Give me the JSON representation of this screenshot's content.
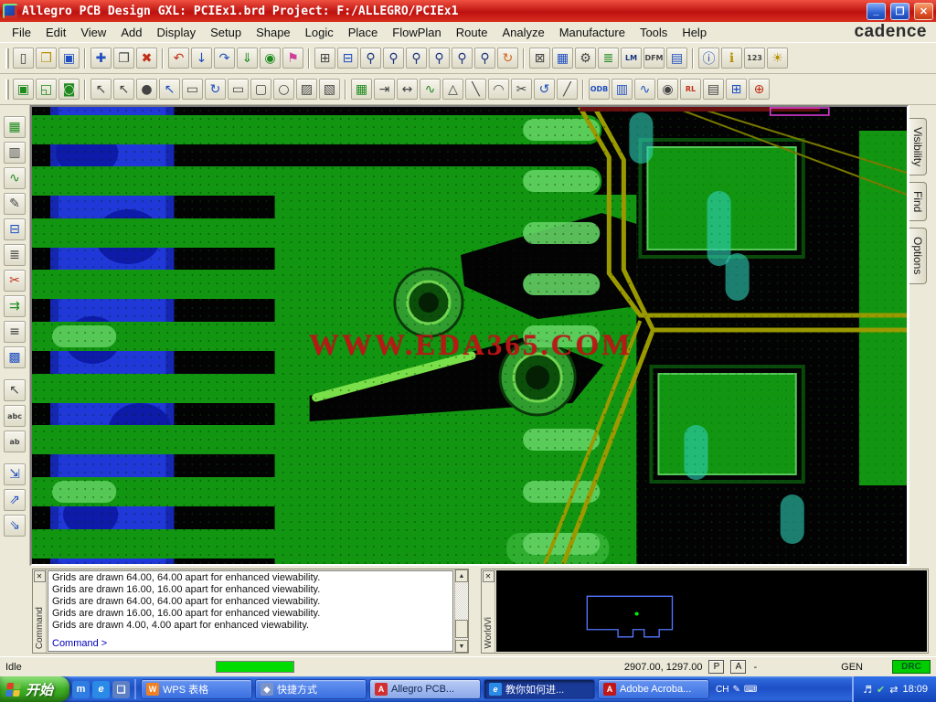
{
  "window": {
    "title": "Allegro PCB Design GXL: PCIEx1.brd  Project: F:/ALLEGRO/PCIEx1",
    "brand": "cadence",
    "minimize": "_",
    "maximize": "❐",
    "close": "✕"
  },
  "menu": {
    "items": [
      "File",
      "Edit",
      "View",
      "Add",
      "Display",
      "Setup",
      "Shape",
      "Logic",
      "Place",
      "FlowPlan",
      "Route",
      "Analyze",
      "Manufacture",
      "Tools",
      "Help"
    ]
  },
  "toolbar_row1": [
    {
      "name": "new-drawing-icon",
      "glyph": "▯"
    },
    {
      "name": "open-drawing-icon",
      "glyph": "❒"
    },
    {
      "name": "save-icon",
      "glyph": "▣"
    },
    {
      "name": "move-icon",
      "glyph": "✚"
    },
    {
      "name": "copy-icon",
      "glyph": "❐"
    },
    {
      "name": "delete-icon",
      "glyph": "✖"
    },
    {
      "name": "undo-icon",
      "glyph": "↶"
    },
    {
      "name": "cancel-icon",
      "glyph": "↓"
    },
    {
      "name": "redo-icon",
      "glyph": "↷"
    },
    {
      "name": "done-icon",
      "glyph": "⇓"
    },
    {
      "name": "zoom-world-icon",
      "glyph": "◉"
    },
    {
      "name": "pin-icon",
      "glyph": "⚑"
    },
    {
      "name": "windows-icon",
      "glyph": "⊞"
    },
    {
      "name": "grid-toggle-icon",
      "glyph": "⊟"
    },
    {
      "name": "zoom-points-icon",
      "glyph": "⚲"
    },
    {
      "name": "zoom-fit-icon",
      "glyph": "⚲"
    },
    {
      "name": "zoom-in-icon",
      "glyph": "⚲"
    },
    {
      "name": "zoom-out-icon",
      "glyph": "⚲"
    },
    {
      "name": "zoom-previous-icon",
      "glyph": "⚲"
    },
    {
      "name": "zoom-selection-icon",
      "glyph": "⚲"
    },
    {
      "name": "redraw-icon",
      "glyph": "↻"
    },
    {
      "name": "rats-all-icon",
      "glyph": "⊠"
    },
    {
      "name": "color-dialog-icon",
      "glyph": "▦"
    },
    {
      "name": "component-icon",
      "glyph": "⚙"
    },
    {
      "name": "layers-icon",
      "glyph": "≣"
    },
    {
      "name": "lm-flow-icon",
      "glyph": "LM"
    },
    {
      "name": "dfm-icon",
      "glyph": "DFM"
    },
    {
      "name": "properties-icon",
      "glyph": "▤"
    },
    {
      "name": "info-icon",
      "glyph": "ⓘ"
    },
    {
      "name": "tip-icon",
      "glyph": "ℹ"
    },
    {
      "name": "numbers-icon",
      "glyph": "123"
    },
    {
      "name": "brightness-icon",
      "glyph": "☀"
    }
  ],
  "toolbar_row2": [
    {
      "name": "shape-select-icon",
      "glyph": "▣"
    },
    {
      "name": "shape-move-icon",
      "glyph": "◱"
    },
    {
      "name": "shape-void-icon",
      "glyph": "◙"
    },
    {
      "name": "pick-add-icon",
      "glyph": "↖"
    },
    {
      "name": "pick-icon",
      "glyph": "↖"
    },
    {
      "name": "disc-icon",
      "glyph": "●"
    },
    {
      "name": "pick-net-icon",
      "glyph": "↖"
    },
    {
      "name": "frame-icon",
      "glyph": "▭"
    },
    {
      "name": "rotate-icon",
      "glyph": "↻"
    },
    {
      "name": "rect-tool-icon",
      "glyph": "▭"
    },
    {
      "name": "rounded-rect-tool-icon",
      "glyph": "▢"
    },
    {
      "name": "circle-tool-icon",
      "glyph": "○"
    },
    {
      "name": "shaded-rect-icon",
      "glyph": "▨"
    },
    {
      "name": "hatch-icon",
      "glyph": "▧"
    },
    {
      "name": "board-geometry-icon",
      "glyph": "▦"
    },
    {
      "name": "dimension-extend-icon",
      "glyph": "⇥"
    },
    {
      "name": "dimension-span-icon",
      "glyph": "↔"
    },
    {
      "name": "wave-icon",
      "glyph": "∿"
    },
    {
      "name": "triangle-tool-icon",
      "glyph": "△"
    },
    {
      "name": "line-tool-icon",
      "glyph": "╲"
    },
    {
      "name": "arc-tool-icon",
      "glyph": "◠"
    },
    {
      "name": "cut-icon",
      "glyph": "✂"
    },
    {
      "name": "spin-icon",
      "glyph": "↺"
    },
    {
      "name": "slash-tool-icon",
      "glyph": "╱"
    },
    {
      "name": "odb-icon",
      "glyph": "ODB"
    },
    {
      "name": "library-icon",
      "glyph": "▥"
    },
    {
      "name": "probe-icon",
      "glyph": "∿"
    },
    {
      "name": "camera-icon",
      "glyph": "◉"
    },
    {
      "name": "rlgc-icon",
      "glyph": "RL"
    },
    {
      "name": "notepad-icon",
      "glyph": "▤"
    },
    {
      "name": "grid-snap-icon",
      "glyph": "⊞"
    },
    {
      "name": "signal-probe-icon",
      "glyph": "⊕"
    }
  ],
  "left_toolbar": [
    {
      "name": "board-outline-icon",
      "glyph": "▦"
    },
    {
      "name": "ui-editor-icon",
      "glyph": "▥"
    },
    {
      "name": "signal-wave-icon",
      "glyph": "∿"
    },
    {
      "name": "pencil-icon",
      "glyph": "✎"
    },
    {
      "name": "package-icon",
      "glyph": "⊟"
    },
    {
      "name": "pin-array-icon",
      "glyph": "≣"
    },
    {
      "name": "trim-icon",
      "glyph": "✂"
    },
    {
      "name": "fanout-icon",
      "glyph": "⇉"
    },
    {
      "name": "report-icon",
      "glyph": "≡"
    },
    {
      "name": "palette-icon",
      "glyph": "▩"
    },
    {
      "name": "pointer-icon",
      "glyph": "↖"
    },
    {
      "name": "text-abc-icon",
      "glyph": "abc"
    },
    {
      "name": "text-edit-icon",
      "glyph": "ab"
    },
    {
      "name": "slide-route-icon",
      "glyph": "⇲"
    },
    {
      "name": "route-up-icon",
      "glyph": "⇗"
    },
    {
      "name": "route-down-icon",
      "glyph": "⇘"
    }
  ],
  "side_tabs": {
    "visibility": "Visibility",
    "find": "Find",
    "options": "Options"
  },
  "canvas": {
    "watermark": "WWW.EDA365.COM"
  },
  "console": {
    "close": "✕",
    "label": "Command",
    "lines": [
      "Grids are drawn 64.00, 64.00 apart for enhanced viewability.",
      "Grids are drawn 16.00, 16.00 apart for enhanced viewability.",
      "Grids are drawn 64.00, 64.00 apart for enhanced viewability.",
      "Grids are drawn 16.00, 16.00 apart for enhanced viewability.",
      "Grids are drawn 4.00, 4.00 apart for enhanced viewability."
    ],
    "prompt": "Command >",
    "scroll_up": "▲",
    "scroll_down": "▼"
  },
  "worldview": {
    "close": "✕",
    "label": "WorldVi"
  },
  "statusbar": {
    "mode": "Idle",
    "coords": "2907.00, 1297.00",
    "pick_button": "P",
    "application_button": "A",
    "dash": "-",
    "drawing_type": "GEN",
    "drc_status": "DRC"
  },
  "taskbar": {
    "start_label": "开始",
    "quicklaunch": [
      {
        "name": "browser-m-icon",
        "glyph": "m"
      },
      {
        "name": "internet-explorer-icon",
        "glyph": "e"
      },
      {
        "name": "show-desktop-icon",
        "glyph": "❏"
      }
    ],
    "tasks": [
      {
        "label": "WPS 表格",
        "glyph": "W"
      },
      {
        "label": "快捷方式",
        "glyph": "◆"
      },
      {
        "label": "Allegro PCB...",
        "glyph": "A"
      },
      {
        "label": "教你如何进...",
        "glyph": "e"
      },
      {
        "label": "Adobe Acroba...",
        "glyph": "A"
      }
    ],
    "indicators": [
      {
        "name": "language-indicator",
        "glyph": "CH"
      },
      {
        "name": "pen-indicator",
        "glyph": "✎"
      },
      {
        "name": "keyboard-indicator",
        "glyph": "⌨"
      }
    ],
    "tray": [
      {
        "name": "volume-icon",
        "glyph": "♬"
      },
      {
        "name": "antivirus-icon",
        "glyph": "✔"
      },
      {
        "name": "network-icon",
        "glyph": "⇄"
      }
    ],
    "time": "18:09"
  },
  "colors": {
    "titlebar_red": "#c41512",
    "board_green": "#129612",
    "highlight_green": "#63d163",
    "layer_blue": "#2038d8",
    "trace_olive": "#9a9a00",
    "drc_green": "#00cc00",
    "taskbar_blue": "#1e4fc6"
  }
}
